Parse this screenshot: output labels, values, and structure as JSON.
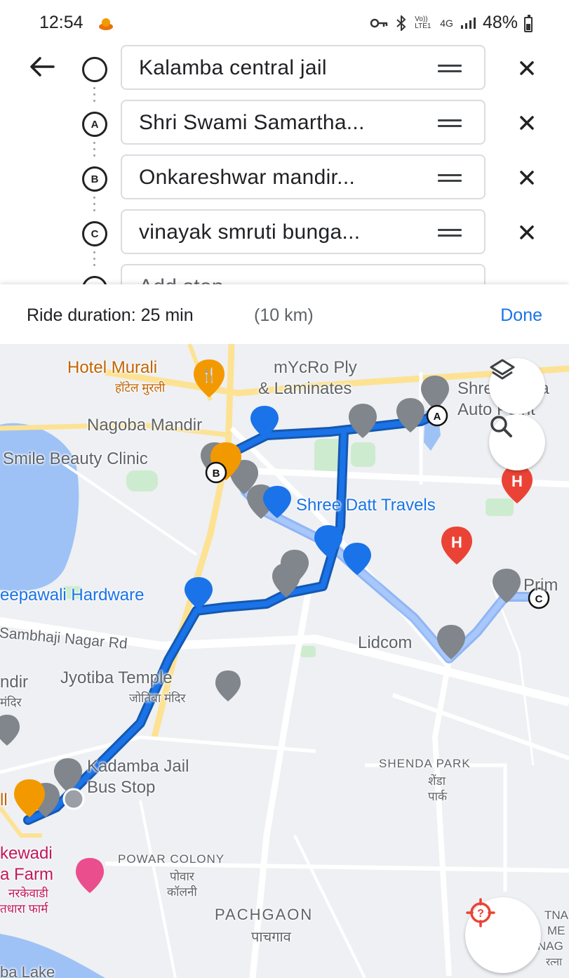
{
  "status": {
    "time": "12:54",
    "network": "4G",
    "volte": "Vo)) LTE1",
    "battery": "48%",
    "battery_level": 0.48
  },
  "route": {
    "stops": [
      {
        "marker": "",
        "value": "Kalamba central jail"
      },
      {
        "marker": "A",
        "value": "Shri Swami Samartha..."
      },
      {
        "marker": "B",
        "value": "Onkareshwar mandir..."
      },
      {
        "marker": "C",
        "value": "vinayak smruti bunga..."
      }
    ],
    "add_stop": {
      "marker": "D",
      "placeholder": "Add stop"
    }
  },
  "duration": {
    "label": "Ride duration: 25 min",
    "distance": "(10 km)",
    "done": "Done"
  },
  "map": {
    "route_color": "#1a73e8",
    "alt_route_color": "#a8c7fa",
    "labels": {
      "hotel_murali": "Hotel Murali",
      "hotel_murali_mr": "हॉटेल मुरली",
      "mycro_1": "mYcRo Ply",
      "mycro_2": "& Laminates",
      "shree_auto_1": "Shree Maha",
      "shree_auto_2": "Auto Point",
      "nagoba": "Nagoba Mandir",
      "smile": "Smile Beauty Clinic",
      "shree_datt": "Shree Datt Travels",
      "deepawali": "eepawali Hardware",
      "sambhaji": "Sambhaji Nagar Rd",
      "lidcom": "Lidcom",
      "prim": "Prim",
      "mandir_partial": "ndir",
      "mandir_partial_mr": "मंदिर",
      "jyotiba": "Jyotiba Temple",
      "jyotiba_mr": "जोतिबा मंदिर",
      "kadamba_1": "Kadamba Jail",
      "kadamba_2": "Bus Stop",
      "shenda": "SHENDA PARK",
      "shenda_mr_1": "शेंडा",
      "shenda_mr_2": "पार्क",
      "ll": "ll",
      "narkewadi_1": "kewadi",
      "narkewadi_2": "a Farm",
      "narkewadi_mr_1": "नरकेवाडी",
      "narkewadi_mr_2": "तधारा फार्म",
      "powar": "POWAR COLONY",
      "powar_mr_1": "पोवार",
      "powar_mr_2": "कॉलनी",
      "pachgaon": "PACHGAON",
      "pachgaon_mr": "पाचगाव",
      "tna_1": "TNA",
      "tna_2": "ME",
      "tna_3": "NAG",
      "tna_4": "रत्ना",
      "bottom_lake": "ba Lake"
    },
    "markers": {
      "a": "A",
      "b": "B",
      "c": "C"
    }
  },
  "icons": {
    "back": "arrow-left-icon",
    "remove": "close-icon",
    "drag": "drag-handle-icon",
    "layers": "layers-icon",
    "search": "search-icon",
    "location": "my-location-icon"
  }
}
